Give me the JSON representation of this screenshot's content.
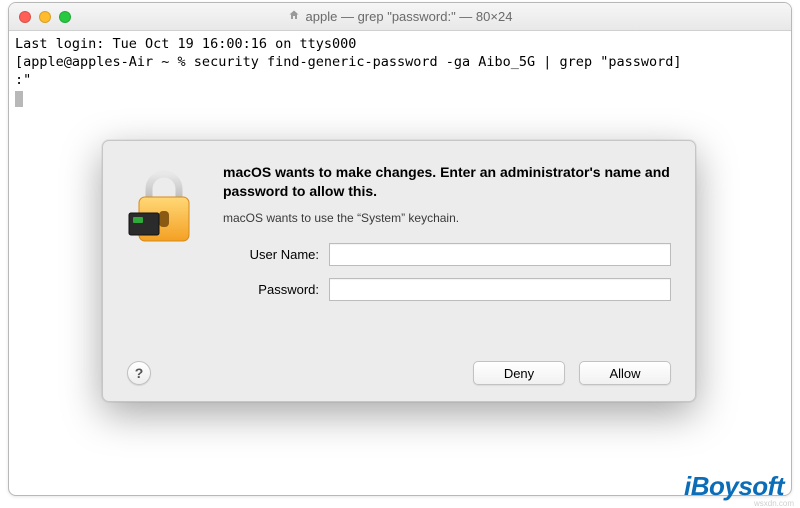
{
  "window": {
    "title": "apple — grep \"password:\" — 80×24"
  },
  "terminal": {
    "line1": "Last login: Tue Oct 19 16:00:16 on ttys000",
    "line2": "[apple@apples-Air ~ % security find-generic-password -ga Aibo_5G | grep \"password]",
    "line3": ":\""
  },
  "dialog": {
    "heading": "macOS wants to make changes. Enter an administrator's name and password to allow this.",
    "sub": "macOS wants to use the “System” keychain.",
    "username_label": "User Name:",
    "password_label": "Password:",
    "username_value": "",
    "password_value": "",
    "help_label": "?",
    "deny_label": "Deny",
    "allow_label": "Allow"
  },
  "watermark": {
    "text": "iBoysoft",
    "url": "wsxdn.com"
  },
  "colors": {
    "dialog_bg": "#ececec",
    "accent_blue": "#0b6db7"
  },
  "icons": {
    "home": "home-icon",
    "lock": "lock-icon"
  }
}
